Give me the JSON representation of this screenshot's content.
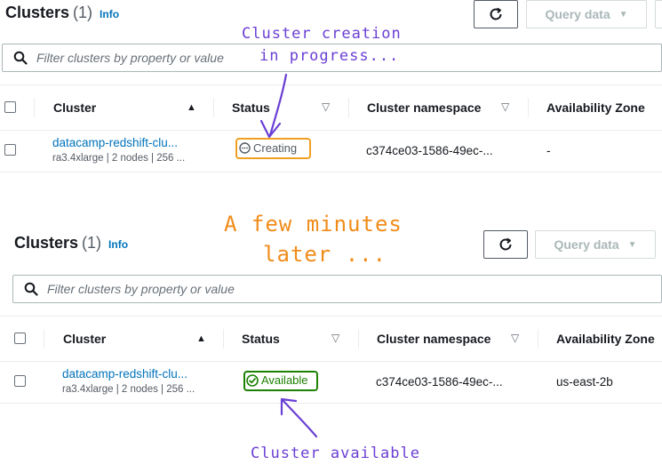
{
  "panels": [
    {
      "title": "Clusters",
      "count": "(1)",
      "info": "Info",
      "query_label": "Query data",
      "search_placeholder": "Filter clusters by property or value",
      "columns": {
        "cluster": "Cluster",
        "status": "Status",
        "namespace": "Cluster namespace",
        "az": "Availability Zone"
      },
      "row": {
        "name": "datacamp-redshift-clu...",
        "details": "ra3.4xlarge | 2 nodes | 256 ...",
        "status": "Creating",
        "namespace": "c374ce03-1586-49ec-...",
        "az": "-"
      }
    },
    {
      "title": "Clusters",
      "count": "(1)",
      "info": "Info",
      "query_label": "Query data",
      "search_placeholder": "Filter clusters by property or value",
      "columns": {
        "cluster": "Cluster",
        "status": "Status",
        "namespace": "Cluster namespace",
        "az": "Availability Zone"
      },
      "row": {
        "name": "datacamp-redshift-clu...",
        "details": "ra3.4xlarge | 2 nodes | 256 ...",
        "status": "Available",
        "namespace": "c374ce03-1586-49ec-...",
        "az": "us-east-2b"
      }
    }
  ],
  "annotations": {
    "creating_line1": "Cluster creation",
    "creating_line2": "in progress...",
    "later_line1": "A few minutes",
    "later_line2": "later ...",
    "available": "Cluster available"
  },
  "icons": {
    "refresh": "refresh-icon",
    "query_dropdown": "caret-down-icon",
    "search": "search-icon",
    "sort_asc": "sort-ascending-icon",
    "sort_desc": "sort-descending-icon",
    "creating": "in-progress-icon",
    "available": "check-circle-icon"
  },
  "colors": {
    "link": "#0073bb",
    "creating_highlight": "#f0a020",
    "available": "#1d8102",
    "annotation_purple": "#6a3fd4",
    "annotation_orange": "#f08c1a"
  }
}
